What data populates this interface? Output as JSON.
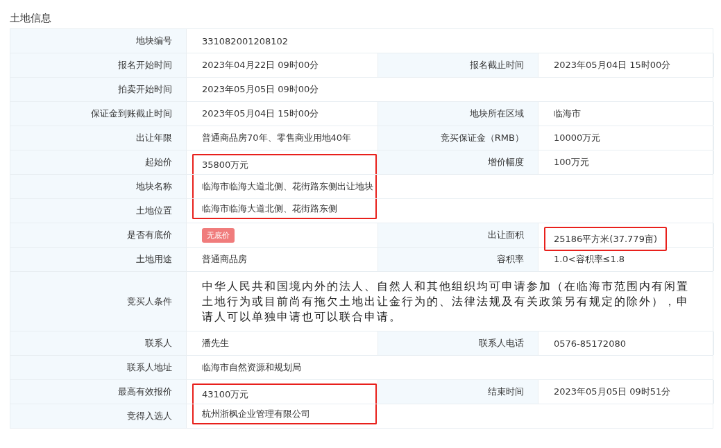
{
  "title": "土地信息",
  "rows": [
    {
      "fields": [
        {
          "label": "地块编号",
          "value": "331082001208102"
        }
      ]
    },
    {
      "fields": [
        {
          "label": "报名开始时间",
          "value": "2023年04月22日 09时00分"
        },
        {
          "label": "报名截止时间",
          "value": "2023年05月04日 15时00分"
        }
      ]
    },
    {
      "fields": [
        {
          "label": "拍卖开始时间",
          "value": "2023年05月05日 09时00分"
        }
      ]
    },
    {
      "fields": [
        {
          "label": "保证金到账截止时间",
          "value": "2023年05月04日 15时00分"
        },
        {
          "label": "地块所在区域",
          "value": "临海市"
        }
      ]
    },
    {
      "fields": [
        {
          "label": "出让年限",
          "value": "普通商品房70年、零售商业用地40年"
        },
        {
          "label": "竞买保证金（RMB）",
          "value": "10000万元"
        }
      ]
    },
    {
      "fields": [
        {
          "label": "起始价",
          "value": "35800万元",
          "highlighted": true
        },
        {
          "label": "增价幅度",
          "value": "100万元"
        }
      ]
    },
    {
      "fields": [
        {
          "label": "地块名称",
          "value": "临海市临海大道北侧、花街路东侧出让地块",
          "highlighted": true
        }
      ]
    },
    {
      "fields": [
        {
          "label": "土地位置",
          "value": "临海市临海大道北侧、花街路东侧",
          "highlighted": true
        }
      ]
    },
    {
      "fields": [
        {
          "label": "是否有底价",
          "value": "无底价",
          "kind": "tag"
        },
        {
          "label": "出让面积",
          "value": "25186平方米(37.779亩)",
          "highlighted": true
        }
      ]
    },
    {
      "fields": [
        {
          "label": "土地用途",
          "value": "普通商品房"
        },
        {
          "label": "容积率",
          "value": "1.0<容积率≤1.8"
        }
      ]
    },
    {
      "fields": [
        {
          "label": "竞买人条件",
          "value": "中华人民共和国境内外的法人、自然人和其他组织均可申请参加（在临海市范围内有闲置土地行为或目前尚有拖欠土地出让金行为的、法律法规及有关政策另有规定的除外），申请人可以单独申请也可以联合申请。",
          "kind": "paragraph"
        }
      ]
    },
    {
      "fields": [
        {
          "label": "联系人",
          "value": "潘先生"
        },
        {
          "label": "联系人电话",
          "value": "0576-85172080"
        }
      ]
    },
    {
      "fields": [
        {
          "label": "联系人地址",
          "value": "临海市自然资源和规划局"
        }
      ]
    },
    {
      "fields": [
        {
          "label": "最高有效报价",
          "value": "43100万元",
          "highlighted": true
        },
        {
          "label": "结束时间",
          "value": "2023年05月05日 09时51分"
        }
      ]
    },
    {
      "fields": [
        {
          "label": "竞得入选人",
          "value": "杭州浙枫企业管理有限公司",
          "highlighted": true
        }
      ]
    }
  ]
}
